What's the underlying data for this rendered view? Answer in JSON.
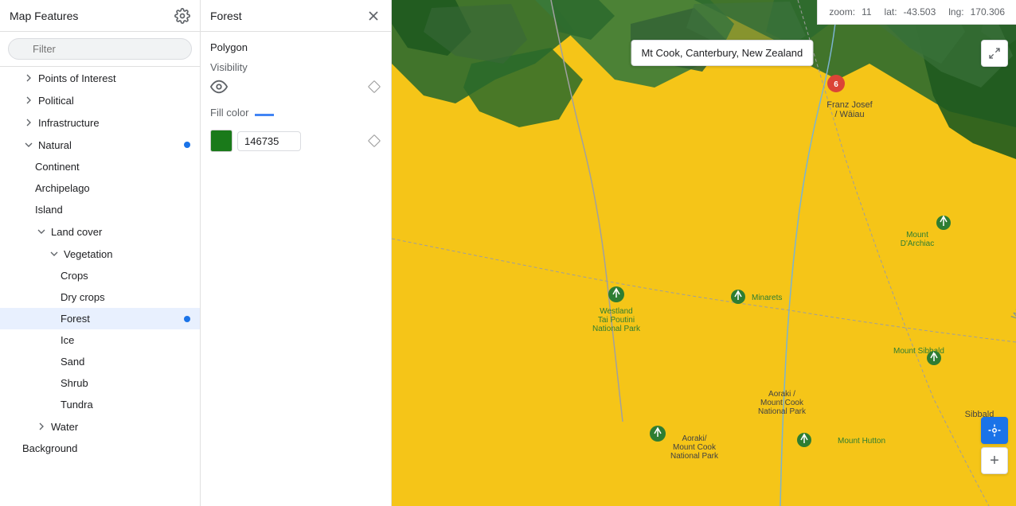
{
  "sidebar": {
    "title": "Map Features",
    "filter_placeholder": "Filter",
    "items": [
      {
        "id": "points-of-interest",
        "label": "Points of Interest",
        "indent": 1,
        "has_chevron": true,
        "chevron_open": false
      },
      {
        "id": "political",
        "label": "Political",
        "indent": 1,
        "has_chevron": true,
        "chevron_open": false
      },
      {
        "id": "infrastructure",
        "label": "Infrastructure",
        "indent": 1,
        "has_chevron": true,
        "chevron_open": false
      },
      {
        "id": "natural",
        "label": "Natural",
        "indent": 1,
        "has_chevron": true,
        "chevron_open": true,
        "has_dot": true
      },
      {
        "id": "continent",
        "label": "Continent",
        "indent": 2
      },
      {
        "id": "archipelago",
        "label": "Archipelago",
        "indent": 2
      },
      {
        "id": "island",
        "label": "Island",
        "indent": 2
      },
      {
        "id": "land-cover",
        "label": "Land cover",
        "indent": 2,
        "has_chevron": true,
        "chevron_open": true
      },
      {
        "id": "vegetation",
        "label": "Vegetation",
        "indent": 3,
        "has_chevron": true,
        "chevron_open": true
      },
      {
        "id": "crops",
        "label": "Crops",
        "indent": 4
      },
      {
        "id": "dry-crops",
        "label": "Dry crops",
        "indent": 4
      },
      {
        "id": "forest",
        "label": "Forest",
        "indent": 4,
        "active": true,
        "has_dot": true
      },
      {
        "id": "ice",
        "label": "Ice",
        "indent": 4
      },
      {
        "id": "sand",
        "label": "Sand",
        "indent": 4
      },
      {
        "id": "shrub",
        "label": "Shrub",
        "indent": 4
      },
      {
        "id": "tundra",
        "label": "Tundra",
        "indent": 4
      },
      {
        "id": "water",
        "label": "Water",
        "indent": 2,
        "has_chevron": true,
        "chevron_open": false
      },
      {
        "id": "background",
        "label": "Background",
        "indent": 1
      }
    ]
  },
  "detail": {
    "title": "Forest",
    "section": "Polygon",
    "visibility_label": "Visibility",
    "fill_color_label": "Fill color",
    "color_hex": "146735",
    "color_value": "#1e7a1e"
  },
  "map": {
    "zoom_label": "zoom:",
    "zoom_value": "11",
    "lat_label": "lat:",
    "lat_value": "-43.503",
    "lng_label": "lng:",
    "lng_value": "170.306",
    "tooltip": "Mt Cook, Canterbury, New Zealand"
  }
}
